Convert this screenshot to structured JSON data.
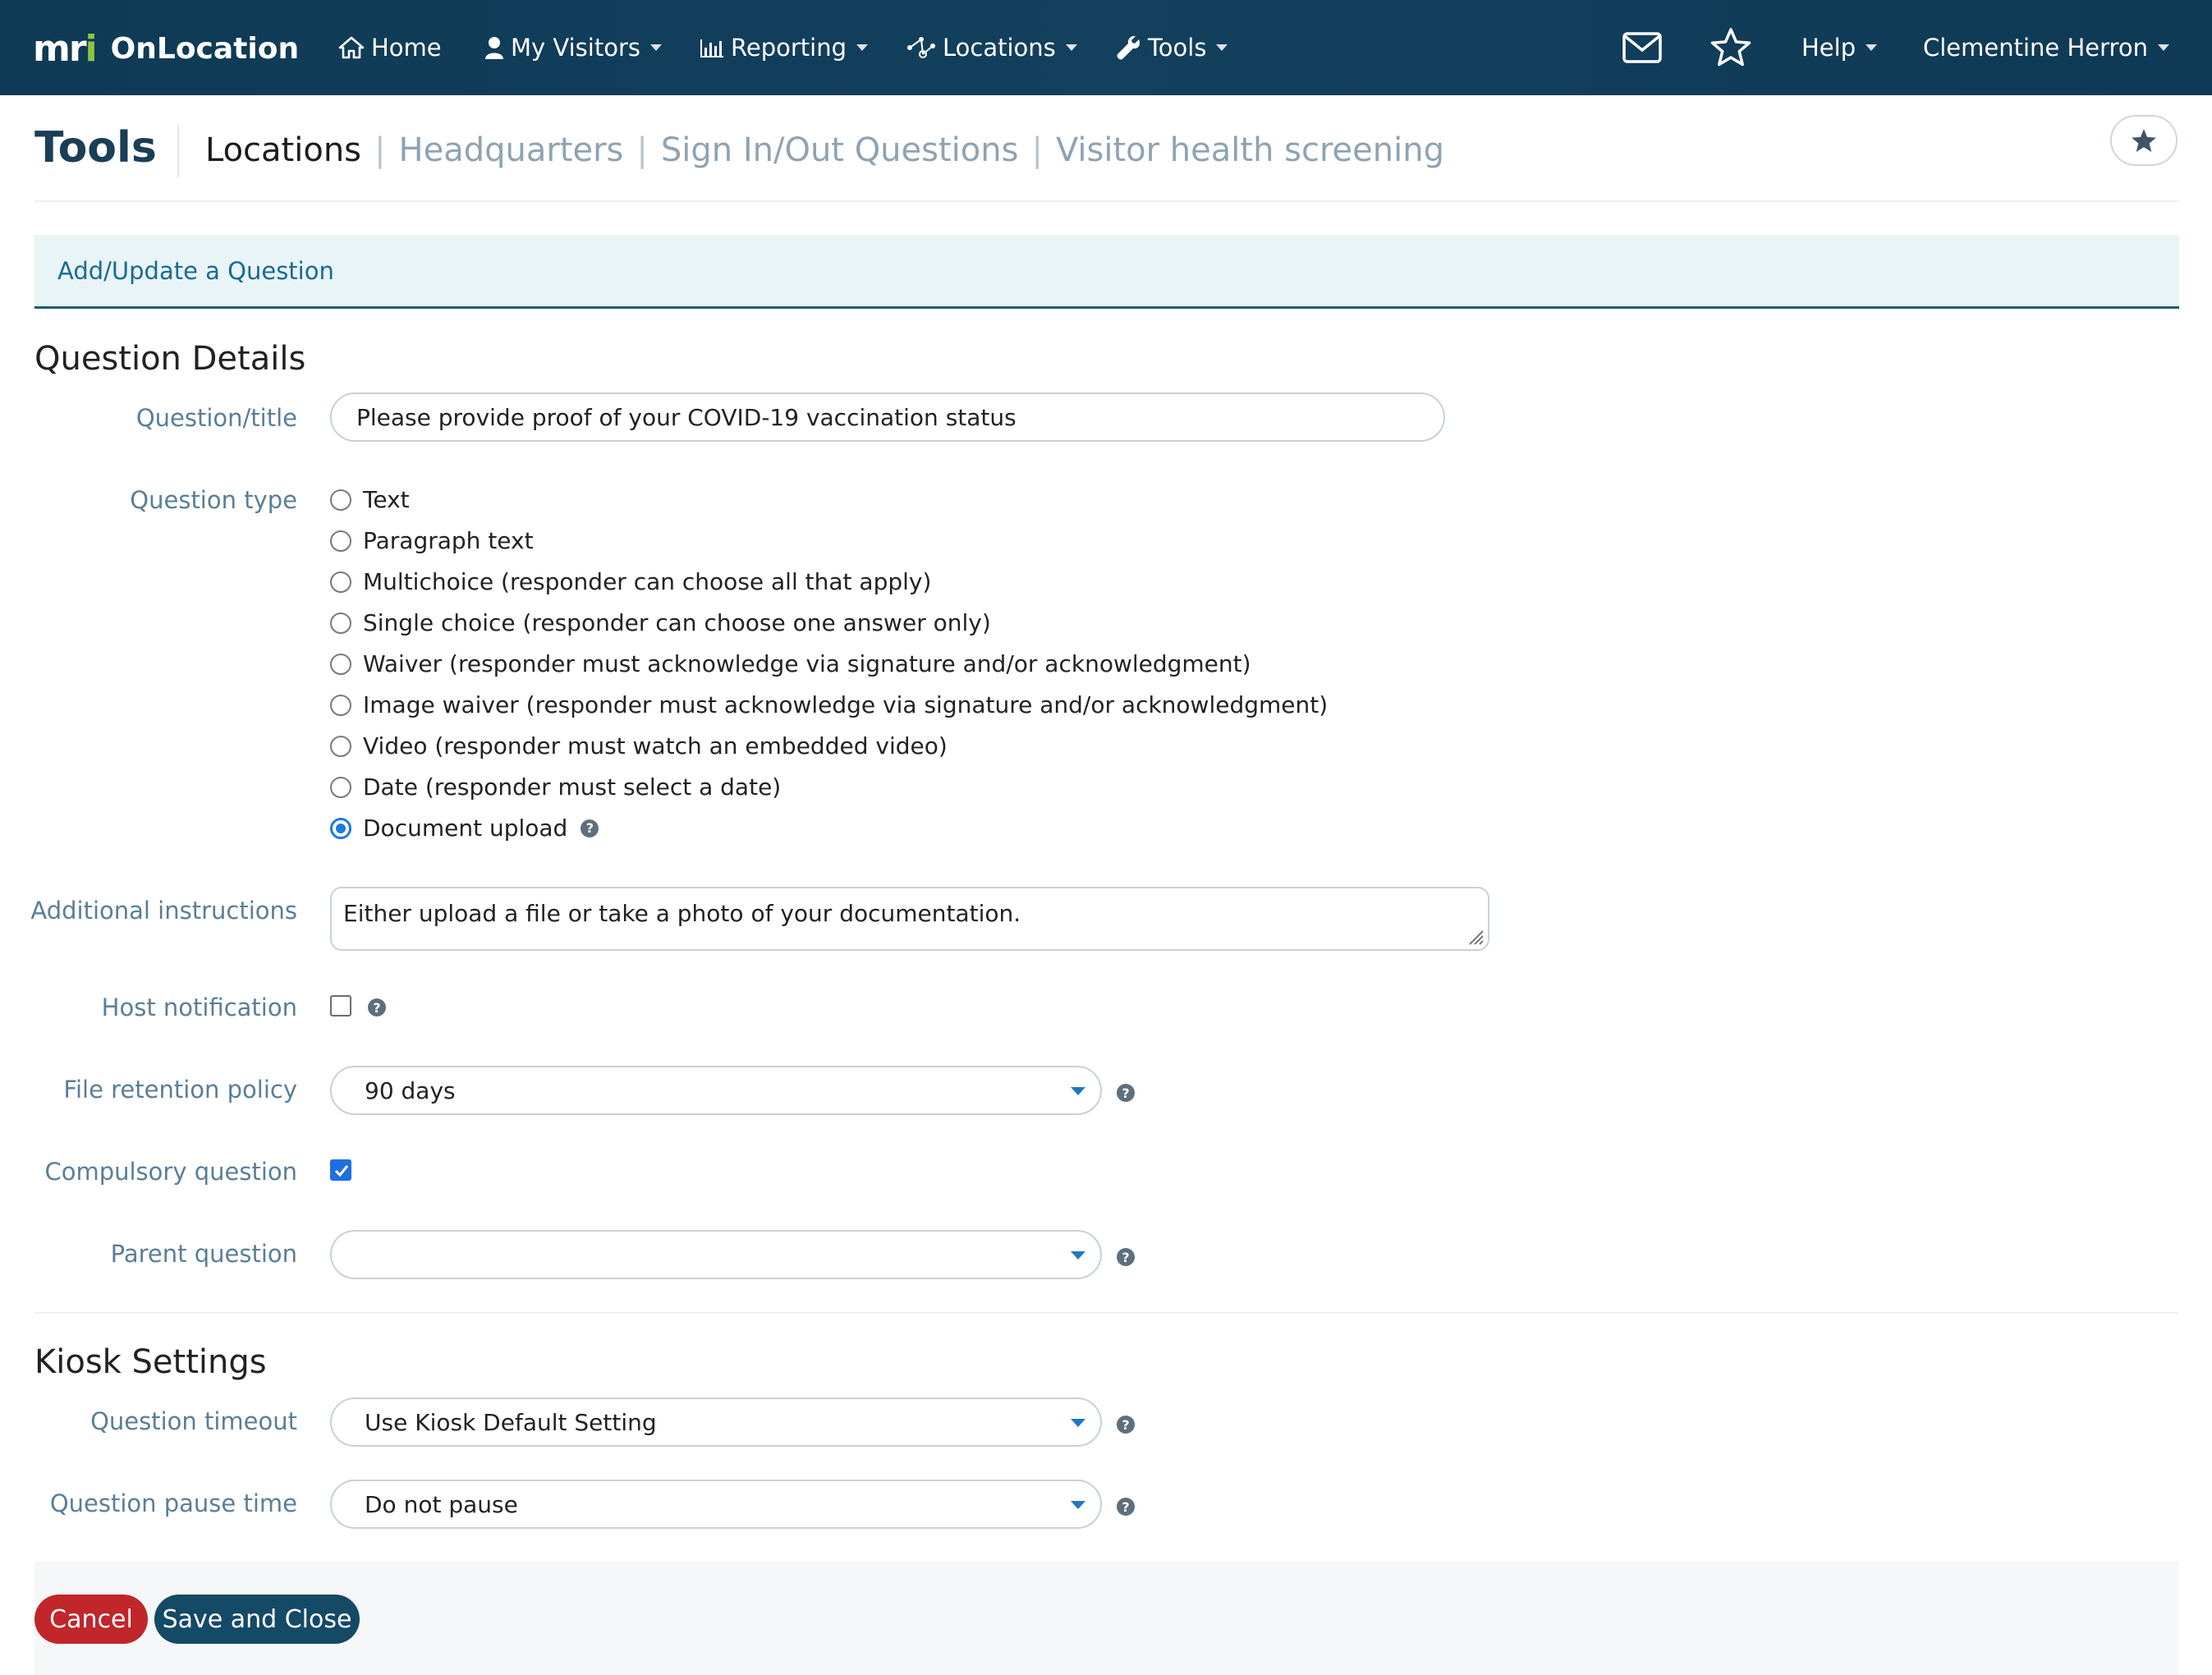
{
  "navbar": {
    "brand_logo_main": "mr",
    "brand_logo_accent": "i",
    "brand_name": "OnLocation",
    "items": [
      {
        "label": "Home",
        "icon": "home-icon"
      },
      {
        "label": "My Visitors",
        "icon": "user-icon"
      },
      {
        "label": "Reporting",
        "icon": "bar-chart-icon"
      },
      {
        "label": "Locations",
        "icon": "network-icon"
      },
      {
        "label": "Tools",
        "icon": "wrench-icon"
      }
    ],
    "help_label": "Help",
    "user_name": "Clementine Herron"
  },
  "header": {
    "title": "Tools",
    "breadcrumb": {
      "current": "Locations",
      "links": [
        "Headquarters",
        "Sign In/Out Questions",
        "Visitor health screening"
      ],
      "separator": "|"
    }
  },
  "panel": {
    "heading": "Add/Update a Question"
  },
  "question_details": {
    "section_title": "Question Details",
    "question_title_label": "Question/title",
    "question_title_value": "Please provide proof of your COVID-19 vaccination status",
    "question_type_label": "Question type",
    "question_types": [
      "Text",
      "Paragraph text",
      "Multichoice (responder can choose all that apply)",
      "Single choice (responder can choose one answer only)",
      "Waiver (responder must acknowledge via signature and/or acknowledgment)",
      "Image waiver (responder must acknowledge via signature and/or acknowledgment)",
      "Video (responder must watch an embedded video)",
      "Date (responder must select a date)",
      "Document upload"
    ],
    "selected_type": "Document upload",
    "additional_instructions_label": "Additional instructions",
    "additional_instructions_value": "Either upload a file or take a photo of your documentation.",
    "host_notification_label": "Host notification",
    "host_notification_checked": false,
    "file_retention_label": "File retention policy",
    "file_retention_value": "90 days",
    "compulsory_label": "Compulsory question",
    "compulsory_checked": true,
    "parent_question_label": "Parent question",
    "parent_question_value": ""
  },
  "kiosk_settings": {
    "section_title": "Kiosk Settings",
    "timeout_label": "Question timeout",
    "timeout_value": "Use Kiosk Default Setting",
    "pause_label": "Question pause time",
    "pause_value": "Do not pause"
  },
  "footer": {
    "cancel_label": "Cancel",
    "save_label": "Save and Close"
  },
  "help_glyph": "?",
  "colors": {
    "navbar": "#12405d",
    "brand_accent": "#8dc63f",
    "label": "#5a7e98",
    "panel_bg": "#e8f4f6",
    "cancel": "#c0262a",
    "save": "#144a66",
    "checked": "#1f6fe0"
  }
}
